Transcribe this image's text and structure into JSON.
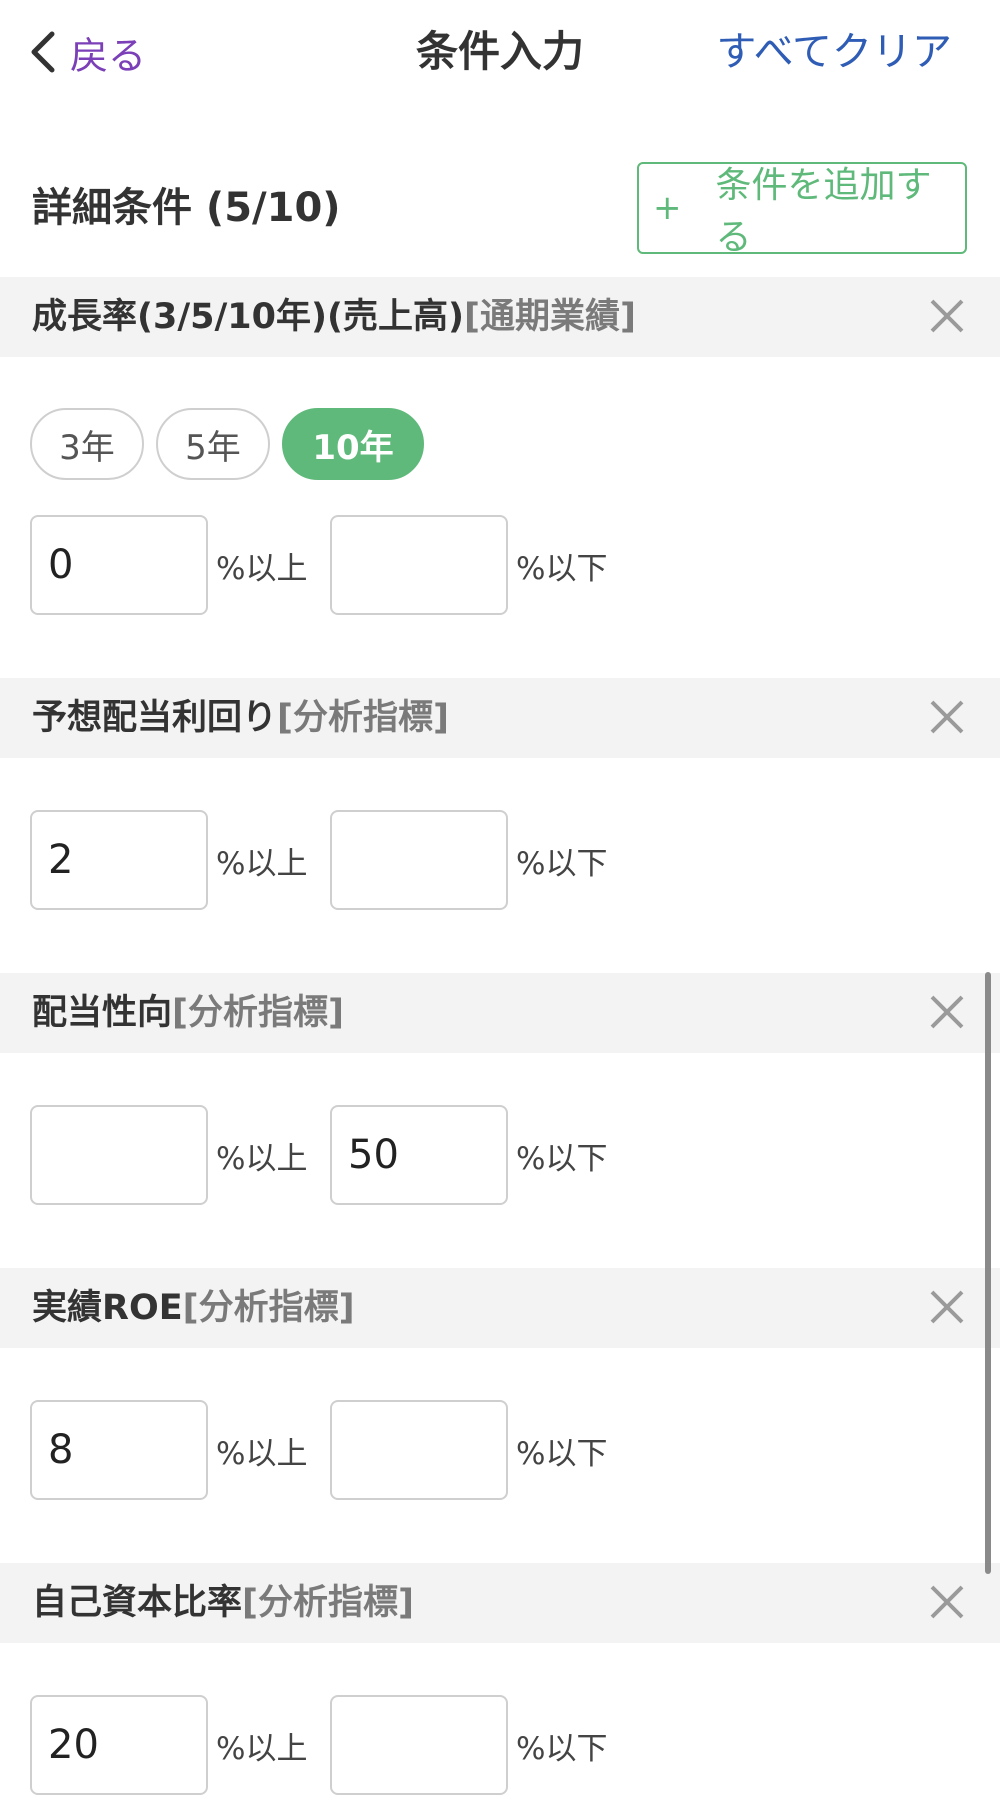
{
  "nav": {
    "back_label": "戻る",
    "title": "条件入力",
    "clear_all": "すべてクリア"
  },
  "detail": {
    "title": "詳細条件 (5/10)",
    "add_plus": "+",
    "add_label": "条件を追加する"
  },
  "unit_min": "%以上",
  "unit_max": "%以下",
  "sections": [
    {
      "name": "成長率(3/5/10年)(売上高)",
      "category": "[通期業績]",
      "min": "0",
      "max": "",
      "periods": [
        {
          "label": "3年",
          "active": false
        },
        {
          "label": "5年",
          "active": false
        },
        {
          "label": "10年",
          "active": true
        }
      ]
    },
    {
      "name": "予想配当利回り",
      "category": "[分析指標]",
      "min": "2",
      "max": ""
    },
    {
      "name": "配当性向",
      "category": "[分析指標]",
      "min": "",
      "max": "50"
    },
    {
      "name": "実績ROE",
      "category": "[分析指標]",
      "min": "8",
      "max": ""
    },
    {
      "name": "自己資本比率",
      "category": "[分析指標]",
      "min": "20",
      "max": ""
    }
  ],
  "colors": {
    "accent_green": "#5fb97a",
    "back_purple": "#7b3fb8",
    "link_blue": "#2f5db5"
  },
  "icons": {
    "back": "chevron-left-icon",
    "close": "close-icon"
  }
}
